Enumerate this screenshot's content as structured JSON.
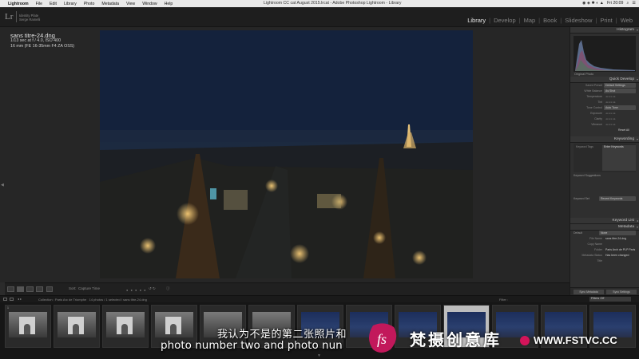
{
  "menubar": {
    "app": "Lightroom",
    "items": [
      "File",
      "Edit",
      "Library",
      "Photo",
      "Metadata",
      "View",
      "Window",
      "Help"
    ],
    "window_title": "Lightroom CC cat August 2015.lrcat - Adobe Photoshop Lightroom - Library",
    "clock": "Fri 20:09"
  },
  "identity": {
    "logo": "Lr",
    "line1": "Identity Plate",
    "line2": "Serge Ramelli"
  },
  "modules": [
    "Library",
    "Develop",
    "Map",
    "Book",
    "Slideshow",
    "Print",
    "Web"
  ],
  "active_module": "Library",
  "info_overlay": {
    "filename": "sans titre-24.dng",
    "exposure": "1/13 sec at f / 4.0, ISO 400",
    "lens": "16 mm (FE 16-35mm F4 ZA OSS)"
  },
  "right_panel": {
    "histogram_title": "Histogram",
    "histogram_caption": "Original Photo",
    "quick_develop_title": "Quick Develop",
    "saved_preset_label": "Saved Preset",
    "saved_preset_value": "Default Settings",
    "white_balance_label": "White Balance",
    "white_balance_value": "As Shot",
    "temperature_label": "Temperature",
    "tint_label": "Tint",
    "tone_control_label": "Tone Control",
    "tone_control_value": "Auto Tone",
    "exposure_label": "Exposure",
    "clarity_label": "Clarity",
    "vibrance_label": "Vibrance",
    "reset_label": "Reset All",
    "keywording_title": "Keywording",
    "keyword_tags_label": "Keyword Tags",
    "keyword_tags_value": "Enter Keywords",
    "keyword_suggestions_label": "Keyword Suggestions",
    "keyword_set_label": "Keyword Set",
    "keyword_set_value": "Recent Keywords",
    "keyword_list_title": "Keyword List",
    "metadata_title": "Metadata",
    "metadata_preset_label": "Default",
    "metadata_preset_value": "None",
    "file_name_label": "File Name",
    "file_name_value": "sans titre-24.dng",
    "copy_name_label": "Copy Name",
    "folder_label": "Folder",
    "folder_value": "Paris Arch de PLP Paris",
    "metadata_status_label": "Metadata Status",
    "metadata_status_value": "Has been changed",
    "title_label": "Title",
    "sync_metadata": "Sync Metadata",
    "sync_settings": "Sync Settings"
  },
  "toolbar": {
    "sort_label": "Sort:",
    "sort_value": "Capture Time"
  },
  "filmstrip_header": {
    "source": "Collection : Paris Arc de Triomphe",
    "count": "14 photos / 1 selected / sans titre-24.dng",
    "filter_label": "Filter :",
    "filter_value": "Filters Off"
  },
  "subtitles": {
    "chinese": "我认为不是的第二张照片和",
    "english": "photo number two and photo nun"
  },
  "watermark": {
    "chinese": "梵摄创意库",
    "url": "WWW.FSTVC.CC"
  }
}
